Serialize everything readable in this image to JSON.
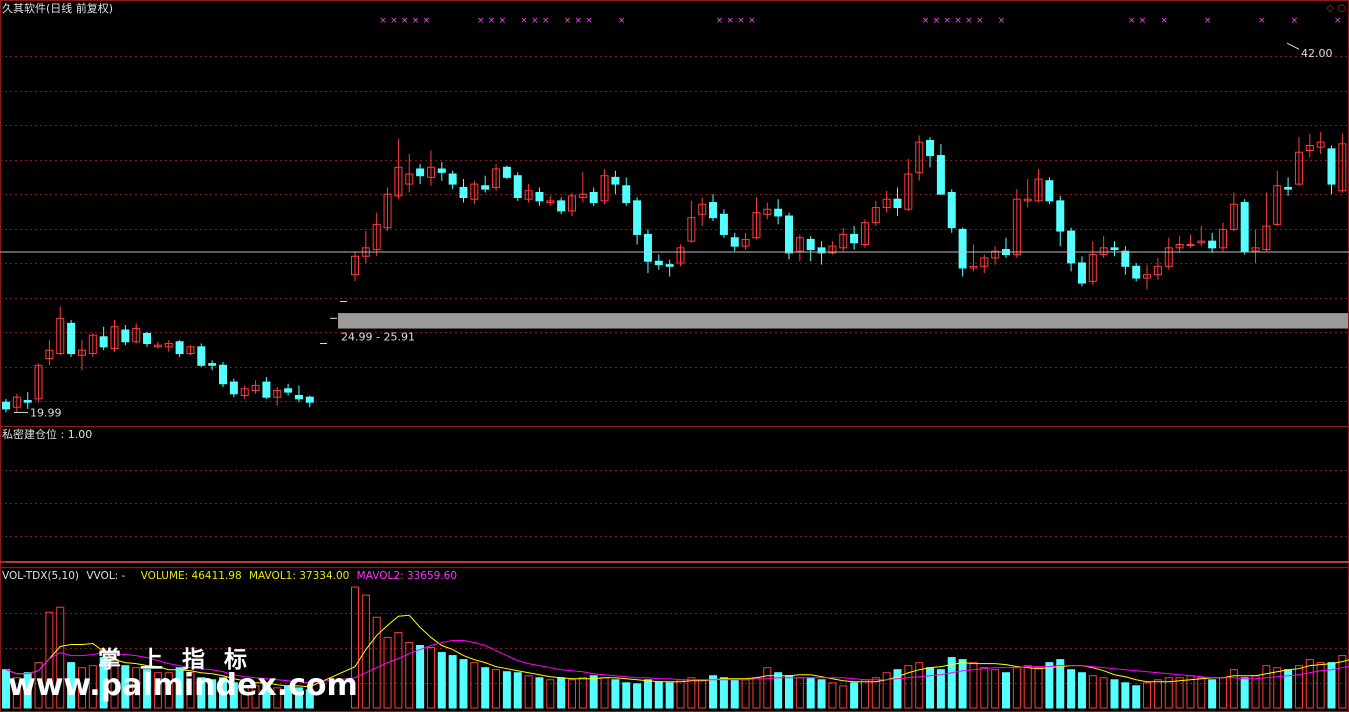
{
  "window": {
    "title": "久其软件(日线 前复权)"
  },
  "corner_icons": "◇ ○",
  "indicator": {
    "title": "私密建仓位 : 1.00"
  },
  "volume_header": {
    "name": "VOL-TDX(5,10)",
    "vvol": "VVOL: -",
    "volume": "VOLUME: 46411.98",
    "mavol1": "MAVOL1: 37334.00",
    "mavol2": "MAVOL2: 33659.60"
  },
  "watermark": {
    "title": "掌上指标",
    "url": "www.palmindex.com"
  },
  "colors": {
    "up": "#ff3b3b",
    "down": "#54ffff",
    "grid": "#8b1a1a",
    "mavol1": "#ffff00",
    "mavol2": "#ff00ff",
    "marker": "#ff44ff",
    "zone": "#9a9a9a"
  },
  "chart_data": [
    {
      "type": "candlestick",
      "ylim": [
        19.3,
        43.5
      ],
      "annotations": {
        "high_label": "42.00",
        "low_label": "19.99",
        "zone_label": "24.99 - 25.91",
        "zone": [
          24.99,
          25.91
        ]
      },
      "crosshair": {
        "index": 128,
        "price": 29.55
      },
      "candles": [
        [
          20.6,
          20.2,
          20.8,
          19.99
        ],
        [
          20.3,
          20.9,
          21.1,
          20.0
        ],
        [
          20.7,
          20.6,
          21.2,
          20.2
        ],
        [
          20.8,
          22.8,
          22.9,
          20.6
        ],
        [
          23.2,
          23.7,
          24.3,
          22.8
        ],
        [
          23.5,
          25.6,
          26.3,
          23.4
        ],
        [
          25.3,
          23.5,
          25.5,
          23.3
        ],
        [
          23.4,
          23.7,
          24.3,
          22.5
        ],
        [
          23.5,
          24.6,
          24.7,
          23.3
        ],
        [
          24.5,
          23.9,
          25.1,
          23.7
        ],
        [
          23.8,
          25.1,
          25.5,
          23.6
        ],
        [
          24.9,
          24.2,
          25.2,
          24.0
        ],
        [
          24.2,
          25.0,
          25.3,
          24.1
        ],
        [
          24.7,
          24.1,
          24.8,
          23.9
        ],
        [
          23.9,
          24.0,
          24.2,
          23.8
        ],
        [
          23.9,
          24.1,
          24.3,
          23.6
        ],
        [
          24.2,
          23.5,
          24.3,
          23.3
        ],
        [
          23.5,
          23.9,
          24.0,
          23.4
        ],
        [
          23.9,
          22.8,
          24.1,
          22.7
        ],
        [
          22.9,
          22.8,
          23.1,
          22.5
        ],
        [
          22.8,
          21.7,
          23.0,
          21.5
        ],
        [
          21.8,
          21.1,
          22.0,
          20.9
        ],
        [
          21.0,
          21.4,
          21.6,
          20.8
        ],
        [
          21.3,
          21.6,
          21.9,
          21.1
        ],
        [
          21.8,
          20.9,
          22.1,
          20.8
        ],
        [
          20.9,
          21.3,
          21.5,
          20.4
        ],
        [
          21.4,
          21.2,
          21.7,
          21.0
        ],
        [
          21.0,
          20.8,
          21.6,
          20.6
        ],
        [
          20.9,
          20.6,
          21.0,
          20.3
        ],
        [
          28.2,
          29.3,
          29.6,
          27.8
        ],
        [
          29.3,
          29.8,
          30.8,
          28.9
        ],
        [
          29.7,
          31.2,
          31.9,
          29.3
        ],
        [
          31.0,
          33.0,
          33.4,
          30.8
        ],
        [
          32.9,
          34.6,
          36.3,
          32.7
        ],
        [
          33.6,
          34.2,
          35.4,
          33.1
        ],
        [
          34.5,
          34.1,
          34.8,
          33.6
        ],
        [
          34.0,
          34.6,
          35.6,
          33.5
        ],
        [
          34.5,
          34.3,
          34.9,
          33.8
        ],
        [
          34.2,
          33.6,
          34.4,
          33.3
        ],
        [
          33.4,
          32.8,
          33.9,
          32.5
        ],
        [
          32.7,
          33.6,
          33.8,
          32.4
        ],
        [
          33.5,
          33.3,
          34.1,
          33.1
        ],
        [
          33.4,
          34.5,
          34.8,
          33.2
        ],
        [
          34.6,
          34.0,
          34.7,
          33.9
        ],
        [
          34.1,
          32.8,
          34.3,
          32.6
        ],
        [
          32.7,
          33.2,
          33.6,
          32.5
        ],
        [
          33.1,
          32.6,
          33.4,
          32.3
        ],
        [
          32.5,
          32.6,
          32.9,
          32.3
        ],
        [
          32.6,
          32.0,
          32.8,
          31.8
        ],
        [
          32.0,
          32.9,
          33.1,
          31.7
        ],
        [
          32.8,
          33.0,
          34.3,
          32.5
        ],
        [
          33.1,
          32.5,
          33.4,
          32.3
        ],
        [
          32.6,
          34.1,
          34.5,
          32.4
        ],
        [
          34.0,
          33.6,
          34.4,
          33.0
        ],
        [
          33.5,
          32.5,
          34.0,
          32.3
        ],
        [
          32.6,
          30.6,
          32.8,
          30.0
        ],
        [
          30.6,
          29.0,
          30.9,
          28.3
        ],
        [
          29.0,
          28.8,
          29.4,
          28.5
        ],
        [
          28.8,
          28.7,
          29.1,
          28.1
        ],
        [
          28.9,
          29.8,
          30.0,
          28.7
        ],
        [
          30.2,
          31.6,
          32.6,
          30.1
        ],
        [
          31.8,
          32.4,
          32.8,
          31.1
        ],
        [
          32.5,
          31.6,
          33.0,
          31.4
        ],
        [
          31.8,
          30.6,
          32.1,
          30.4
        ],
        [
          30.4,
          29.9,
          30.7,
          29.6
        ],
        [
          29.9,
          30.3,
          30.7,
          29.7
        ],
        [
          30.4,
          31.9,
          32.8,
          30.3
        ],
        [
          31.8,
          32.1,
          32.5,
          31.5
        ],
        [
          32.1,
          31.7,
          32.7,
          31.2
        ],
        [
          31.7,
          29.5,
          31.9,
          29.1
        ],
        [
          29.6,
          30.4,
          30.6,
          29.0
        ],
        [
          30.3,
          29.7,
          30.5,
          29.0
        ],
        [
          29.8,
          29.5,
          30.2,
          28.8
        ],
        [
          29.5,
          29.9,
          30.2,
          29.4
        ],
        [
          29.8,
          30.6,
          31.0,
          29.6
        ],
        [
          30.6,
          30.1,
          31.1,
          29.7
        ],
        [
          30.0,
          31.3,
          31.5,
          29.8
        ],
        [
          31.3,
          32.2,
          32.6,
          31.1
        ],
        [
          32.2,
          32.7,
          33.2,
          31.9
        ],
        [
          32.7,
          32.2,
          33.4,
          31.7
        ],
        [
          32.1,
          34.2,
          35.1,
          32.0
        ],
        [
          34.3,
          36.1,
          36.5,
          33.8
        ],
        [
          36.2,
          35.3,
          36.4,
          34.6
        ],
        [
          35.3,
          33.0,
          36.0,
          33.3
        ],
        [
          33.1,
          31.0,
          33.3,
          30.7
        ],
        [
          30.9,
          28.6,
          31.0,
          28.1
        ],
        [
          28.6,
          28.7,
          30.0,
          28.4
        ],
        [
          28.7,
          29.2,
          29.4,
          28.3
        ],
        [
          29.2,
          29.6,
          29.9,
          28.8
        ],
        [
          29.7,
          29.4,
          30.4,
          29.2
        ],
        [
          29.4,
          32.7,
          33.3,
          29.2
        ],
        [
          32.6,
          32.7,
          33.9,
          32.2
        ],
        [
          32.6,
          33.9,
          34.5,
          32.5
        ],
        [
          33.8,
          32.6,
          34.0,
          32.4
        ],
        [
          32.6,
          30.8,
          32.9,
          29.9
        ],
        [
          30.8,
          28.9,
          31.0,
          28.4
        ],
        [
          28.9,
          27.7,
          29.3,
          27.5
        ],
        [
          27.8,
          29.4,
          30.2,
          27.6
        ],
        [
          29.4,
          29.8,
          30.5,
          29.2
        ],
        [
          29.8,
          29.7,
          30.2,
          29.3
        ],
        [
          29.6,
          28.7,
          29.9,
          28.2
        ],
        [
          28.7,
          28.0,
          28.9,
          27.8
        ],
        [
          28.0,
          28.2,
          28.8,
          27.3
        ],
        [
          28.2,
          28.7,
          29.2,
          27.9
        ],
        [
          28.7,
          29.8,
          30.4,
          28.5
        ],
        [
          29.8,
          30.0,
          30.5,
          29.5
        ],
        [
          30.0,
          30.0,
          30.6,
          29.8
        ],
        [
          30.1,
          30.2,
          31.1,
          29.9
        ],
        [
          30.2,
          29.8,
          30.7,
          29.5
        ],
        [
          29.8,
          30.9,
          31.3,
          29.6
        ],
        [
          30.9,
          32.4,
          33.1,
          30.8
        ],
        [
          32.5,
          29.6,
          32.7,
          29.4
        ],
        [
          29.6,
          29.8,
          30.9,
          28.9
        ],
        [
          29.7,
          31.1,
          33.1,
          29.6
        ],
        [
          31.2,
          33.5,
          34.4,
          31.1
        ],
        [
          33.4,
          33.3,
          34.0,
          32.9
        ],
        [
          33.6,
          35.5,
          36.4,
          33.5
        ],
        [
          35.6,
          35.9,
          36.6,
          35.2
        ],
        [
          35.8,
          36.1,
          36.7,
          35.4
        ],
        [
          35.7,
          33.6,
          35.9,
          33.0
        ],
        [
          33.2,
          36.0,
          36.6,
          33.1
        ],
        [
          36.2,
          39.5,
          40.1,
          35.8
        ],
        [
          39.8,
          39.3,
          42.0,
          38.6
        ],
        [
          39.5,
          40.7,
          42.0,
          38.6
        ],
        [
          40.8,
          39.9,
          41.5,
          38.5
        ],
        [
          40.2,
          37.8,
          41.2,
          37.6
        ]
      ]
    },
    {
      "type": "line",
      "name": "私密建仓位",
      "values": "0 at all bars, 1.00 at index 128"
    },
    {
      "type": "bar",
      "name": "VOL-TDX",
      "ylim": [
        0,
        125
      ],
      "values": [
        38,
        30,
        35,
        45,
        95,
        100,
        45,
        40,
        42,
        50,
        48,
        42,
        40,
        38,
        35,
        35,
        40,
        35,
        30,
        28,
        30,
        25,
        22,
        22,
        25,
        20,
        22,
        20,
        18,
        120,
        112,
        90,
        70,
        75,
        65,
        62,
        60,
        55,
        52,
        48,
        45,
        40,
        38,
        36,
        35,
        32,
        30,
        28,
        30,
        28,
        30,
        32,
        30,
        28,
        25,
        24,
        28,
        26,
        25,
        28,
        30,
        28,
        32,
        30,
        28,
        28,
        30,
        40,
        35,
        32,
        30,
        30,
        28,
        25,
        22,
        25,
        28,
        30,
        35,
        38,
        42,
        45,
        40,
        38,
        50,
        48,
        45,
        40,
        38,
        35,
        40,
        42,
        40,
        45,
        48,
        38,
        35,
        32,
        30,
        28,
        25,
        22,
        25,
        28,
        30,
        30,
        32,
        30,
        28,
        30,
        38,
        30,
        32,
        42,
        40,
        38,
        42,
        48,
        45,
        45,
        52,
        60,
        55,
        50,
        45,
        40,
        35,
        38,
        70,
        60,
        55,
        50,
        48,
        45,
        52,
        55,
        50,
        62,
        52,
        38,
        36
      ],
      "mavol1": [
        38,
        34,
        34,
        37,
        49,
        61,
        63,
        63,
        64,
        56,
        48,
        45,
        44,
        42,
        41,
        38,
        38,
        37,
        35,
        34,
        32,
        29,
        27,
        25,
        25,
        23,
        22,
        22,
        21,
        41,
        58,
        72,
        82,
        91,
        92,
        80,
        70,
        62,
        58,
        52,
        48,
        45,
        41,
        39,
        37,
        35,
        33,
        31,
        30,
        29,
        29,
        29,
        30,
        30,
        29,
        28,
        27,
        26,
        26,
        26,
        27,
        27,
        28,
        29,
        29,
        29,
        30,
        32,
        32,
        32,
        33,
        33,
        31,
        29,
        27,
        26,
        26,
        26,
        28,
        31,
        35,
        38,
        40,
        41,
        43,
        45,
        44,
        44,
        44,
        43,
        41,
        40,
        39,
        40,
        41,
        42,
        42,
        40,
        37,
        33,
        31,
        28,
        26,
        26,
        26,
        27,
        28,
        29,
        30,
        30,
        32,
        32,
        32,
        34,
        36,
        38,
        39,
        42,
        43,
        44,
        46,
        49,
        52,
        52,
        51,
        50,
        47,
        44,
        48,
        51,
        53,
        53,
        53,
        52,
        50,
        51,
        50,
        54,
        54,
        51,
        48
      ],
      "mavol2": [
        38,
        34,
        34,
        37,
        49,
        55,
        52,
        52,
        53,
        55,
        54,
        53,
        52,
        50,
        47,
        44,
        42,
        40,
        39,
        38,
        36,
        33,
        31,
        30,
        29,
        28,
        27,
        26,
        25,
        30,
        35,
        40,
        45,
        49,
        54,
        58,
        62,
        65,
        67,
        67,
        65,
        62,
        57,
        52,
        47,
        44,
        42,
        40,
        38,
        37,
        36,
        34,
        33,
        32,
        31,
        30,
        30,
        29,
        29,
        28,
        28,
        28,
        28,
        28,
        28,
        28,
        29,
        29,
        30,
        30,
        30,
        30,
        30,
        30,
        30,
        29,
        28,
        28,
        28,
        29,
        30,
        31,
        32,
        33,
        35,
        37,
        38,
        39,
        40,
        40,
        40,
        41,
        41,
        41,
        42,
        42,
        42,
        41,
        40,
        39,
        38,
        37,
        36,
        35,
        34,
        33,
        32,
        31,
        30,
        30,
        30,
        29,
        29,
        30,
        31,
        32,
        33,
        35,
        37,
        38,
        40,
        42,
        44,
        45,
        46,
        47,
        47,
        47,
        47,
        48,
        48,
        48,
        48,
        48,
        48,
        48,
        49,
        50,
        51,
        51,
        51
      ]
    }
  ]
}
